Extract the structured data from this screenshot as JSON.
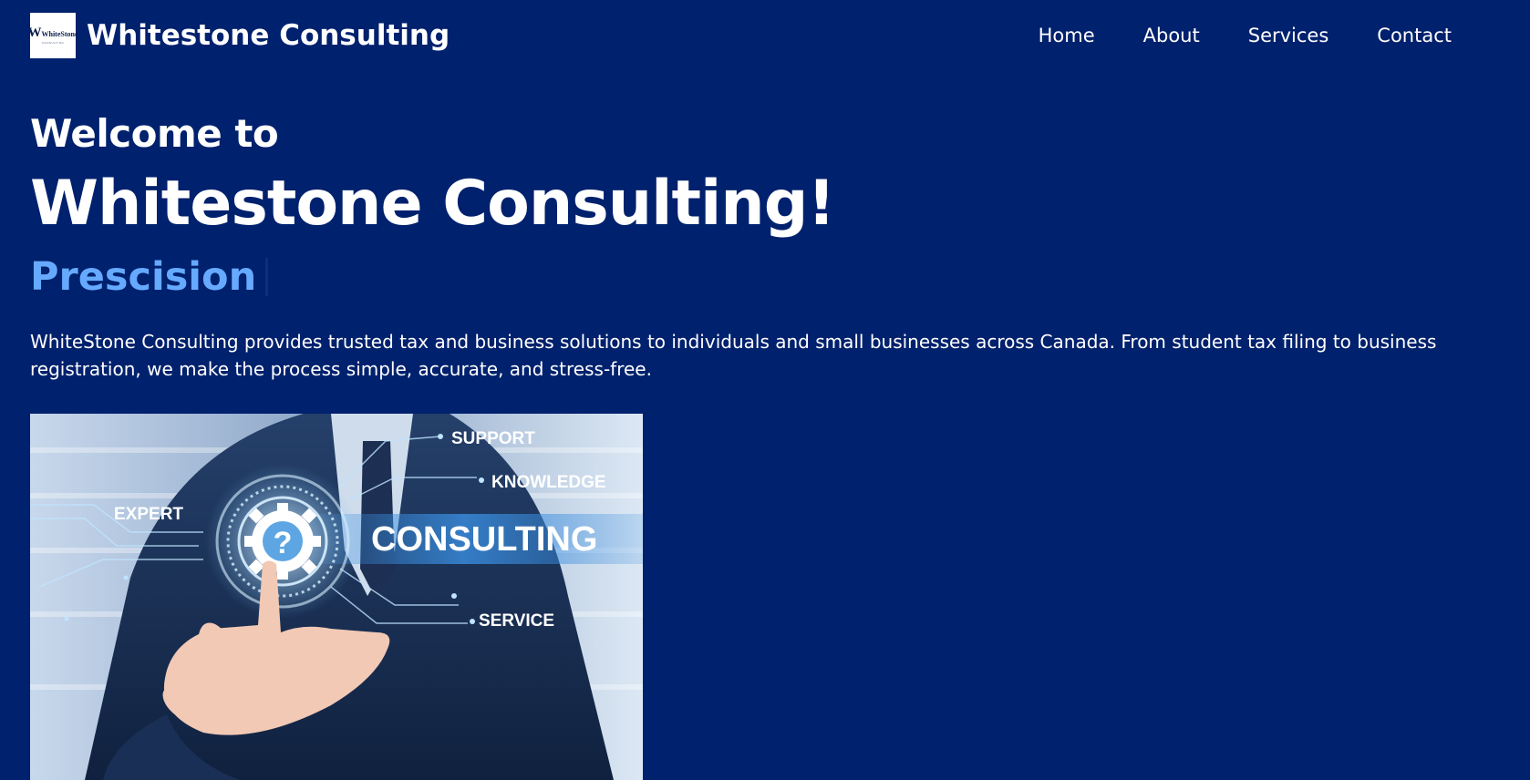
{
  "header": {
    "logo": {
      "mark": "W",
      "word": "WhiteStone",
      "sub": "CONSULTING",
      "icon": "company-logo"
    },
    "brand": "Whitestone Consulting",
    "nav": [
      "Home",
      "About",
      "Services",
      "Contact"
    ]
  },
  "hero": {
    "welcome": "Welcome to",
    "headline": "Whitestone Consulting!",
    "typed_word": "Prescision",
    "intro": "WhiteStone Consulting provides trusted tax and business solutions to individuals and small businesses across Canada. From student tax filing to business registration, we make the process simple, accurate, and stress-free.",
    "image": {
      "labels": [
        "SUPPORT",
        "KNOWLEDGE",
        "EXPERT",
        "CONSULTING",
        "SERVICE"
      ],
      "gear_mark": "?"
    }
  },
  "colors": {
    "background": "#00216d",
    "text": "#ffffff",
    "accent": "#66aaff"
  }
}
